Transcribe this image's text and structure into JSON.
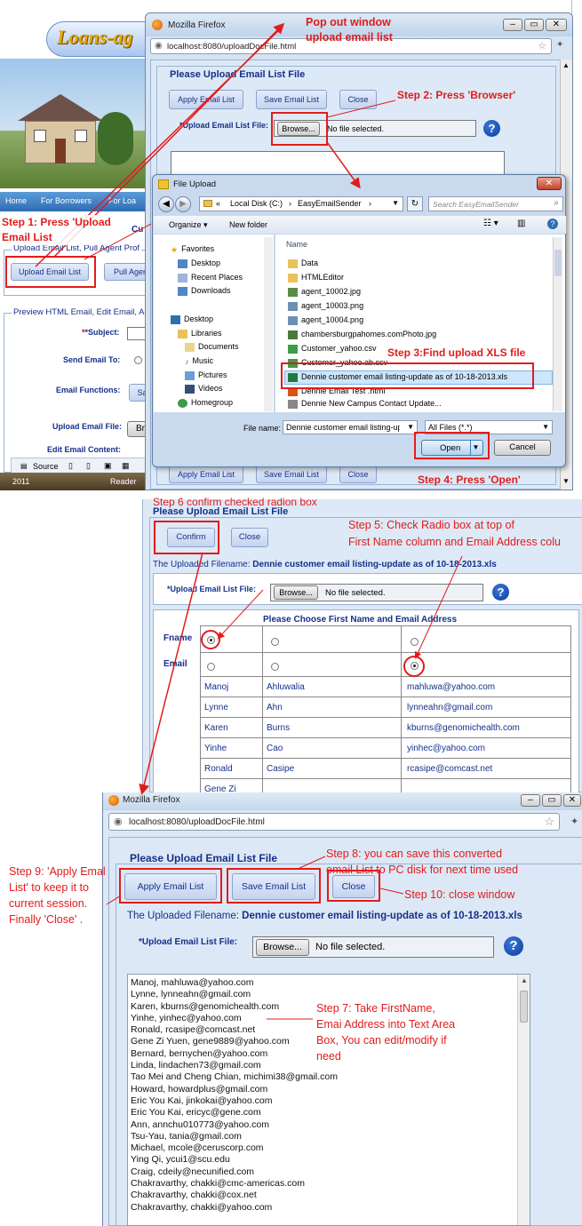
{
  "background_page": {
    "logo_text": "Loans-ag",
    "nav": [
      "Home",
      "For Borrowers",
      "For Loa"
    ],
    "cu_text": "Cu",
    "upload_section_legend": "Upload Email List, Pull Agent Prof",
    "upload_email_list_btn": "Upload Email List",
    "pull_agent_btn": "Pull Agen",
    "preview_section_legend": "Preview HTML Email, Edit Email, A",
    "subject_label": "*Subject:",
    "send_email_to_label": "Send Email To:",
    "email_functions_label": "Email Functions:",
    "email_functions_btn": "Sa",
    "upload_email_file_label": "Upload Email File:",
    "upload_email_file_btn": "Br",
    "edit_email_content_label": "Edit Email Content:",
    "source_label": "Source",
    "footer_year": "2011",
    "footer_reader": "Reader"
  },
  "popup1": {
    "window_title": "Mozilla Firefox",
    "url": "localhost:8080/uploadDocFile.html",
    "heading": "Please Upload Email List File",
    "apply_btn": "Apply Email List",
    "save_btn": "Save Email List",
    "close_btn": "Close",
    "file_label": "*Upload Email List File:",
    "browse_btn": "Browse...",
    "no_file": "No file selected.",
    "help_icon": "?",
    "bottom_apply": "Apply Email List",
    "bottom_save": "Save Email List",
    "bottom_close": "Close"
  },
  "file_dialog": {
    "title": "File Upload",
    "breadcrumb_prefix": "«",
    "breadcrumb_1": "Local Disk (C:)",
    "breadcrumb_sep": "›",
    "breadcrumb_2": "EasyEmailSender",
    "search_placeholder": "Search EasyEmailSender",
    "organize": "Organize ▾",
    "new_folder": "New folder",
    "column_name": "Name",
    "favorites": "Favorites",
    "nav_items": [
      "Desktop",
      "Recent Places",
      "Downloads"
    ],
    "desktop": "Desktop",
    "libraries": "Libraries",
    "library_items": [
      "Documents",
      "Music",
      "Pictures",
      "Videos"
    ],
    "homegroup": "Homegroup",
    "files": [
      "Data",
      "HTMLEditor",
      "agent_10002.jpg",
      "agent_10003.png",
      "agent_10004.png",
      "chambersburgpahomes.comPhoto.jpg",
      "Customer_yahoo.csv",
      "Customer_yahoo.ab.csv",
      "Dennie customer email listing-update as of 10-18-2013.xls",
      "Dennie Email Test .html",
      "Dennie New Campus Contact Update..."
    ],
    "file_name_label": "File name:",
    "file_name_value": "Dennie customer email listing-upd",
    "file_type": "All Files (*.*)",
    "open_btn": "Open",
    "cancel_btn": "Cancel"
  },
  "panel2": {
    "heading": "Please Upload Email List File",
    "confirm_btn": "Confirm",
    "close_btn": "Close",
    "uploaded_label": "The Uploaded Filename:",
    "uploaded_value": "Dennie customer email listing-update as of 10-18-2013.xls",
    "file_label": "*Upload Email List File:",
    "browse_btn": "Browse...",
    "no_file": "No file selected.",
    "help_icon": "?",
    "table_title": "Please Choose First Name and Email Address",
    "fname_label": "Fname",
    "email_label": "Email",
    "rows": [
      [
        "Manoj",
        "Ahluwalia",
        "mahluwa@yahoo.com"
      ],
      [
        "Lynne",
        "Ahn",
        "lynneahn@gmail.com"
      ],
      [
        "Karen",
        "Burns",
        "kburns@genomichealth.com"
      ],
      [
        "Yinhe",
        "Cao",
        "yinhec@yahoo.com"
      ],
      [
        "Ronald",
        "Casipe",
        "rcasipe@comcast.net"
      ],
      [
        "Gene Zi",
        "",
        ""
      ]
    ]
  },
  "popup3": {
    "window_title": "Mozilla Firefox",
    "url": "localhost:8080/uploadDocFile.html",
    "heading": "Please Upload Email List File",
    "apply_btn": "Apply Email List",
    "save_btn": "Save Email List",
    "close_btn": "Close",
    "uploaded_label": "The Uploaded Filename:",
    "uploaded_value": "Dennie customer email listing-update as of 10-18-2013.xls",
    "file_label": "*Upload Email List File:",
    "browse_btn": "Browse...",
    "no_file": "No file selected.",
    "help_icon": "?",
    "textarea_lines": [
      "Manoj, mahluwa@yahoo.com",
      "Lynne, lynneahn@gmail.com",
      "Karen, kburns@genomichealth.com",
      "Yinhe, yinhec@yahoo.com",
      "Ronald, rcasipe@comcast.net",
      "Gene Zi Yuen, gene9889@yahoo.com",
      "Bernard, bernychen@yahoo.com",
      "Linda, lindachen73@gmail.com",
      "Tao Mei and Cheng Chian, michimi38@gmail.com",
      "Howard, howardplus@gmail.com",
      "Eric You Kai, jinkokai@yahoo.com",
      "Eric You Kai, ericyc@gene.com",
      "Ann, annchu010773@yahoo.com",
      "Tsu-Yau, tania@gmail.com",
      "Michael, mcole@ceruscorp.com",
      "Ying Qi, ycui1@scu.edu",
      "Craig, cdeily@necunified.com",
      "Chakravarthy, chakki@cmc-americas.com",
      "Chakravarthy, chakki@cox.net",
      "Chakravarthy, chakki@yahoo.com"
    ]
  },
  "annotations": {
    "popout": "Pop out window\nupload email list",
    "step1": "Step 1: Press 'Upload\nEmail List",
    "step2": "Step 2: Press 'Browser'",
    "step3": "Step 3:Find upload XLS file",
    "step4": "Step 4: Press 'Open'",
    "step5": "Step 5: Check Radio box at top of\nFirst Name column and Email Address colu",
    "step6": "Step 6 confirm checked radion box",
    "step7": "Step 7: Take FirstName,\nEmai Address into Text Area\nBox, You can edit/modify if\nneed",
    "step8": "Step 8: you can save this converted\nemail List to PC disk for next time used",
    "step9": "Step 9: 'Apply Emal\nList' to keep it to\ncurrent session.\nFinally 'Close' .",
    "step10": "Step 10: close window"
  }
}
